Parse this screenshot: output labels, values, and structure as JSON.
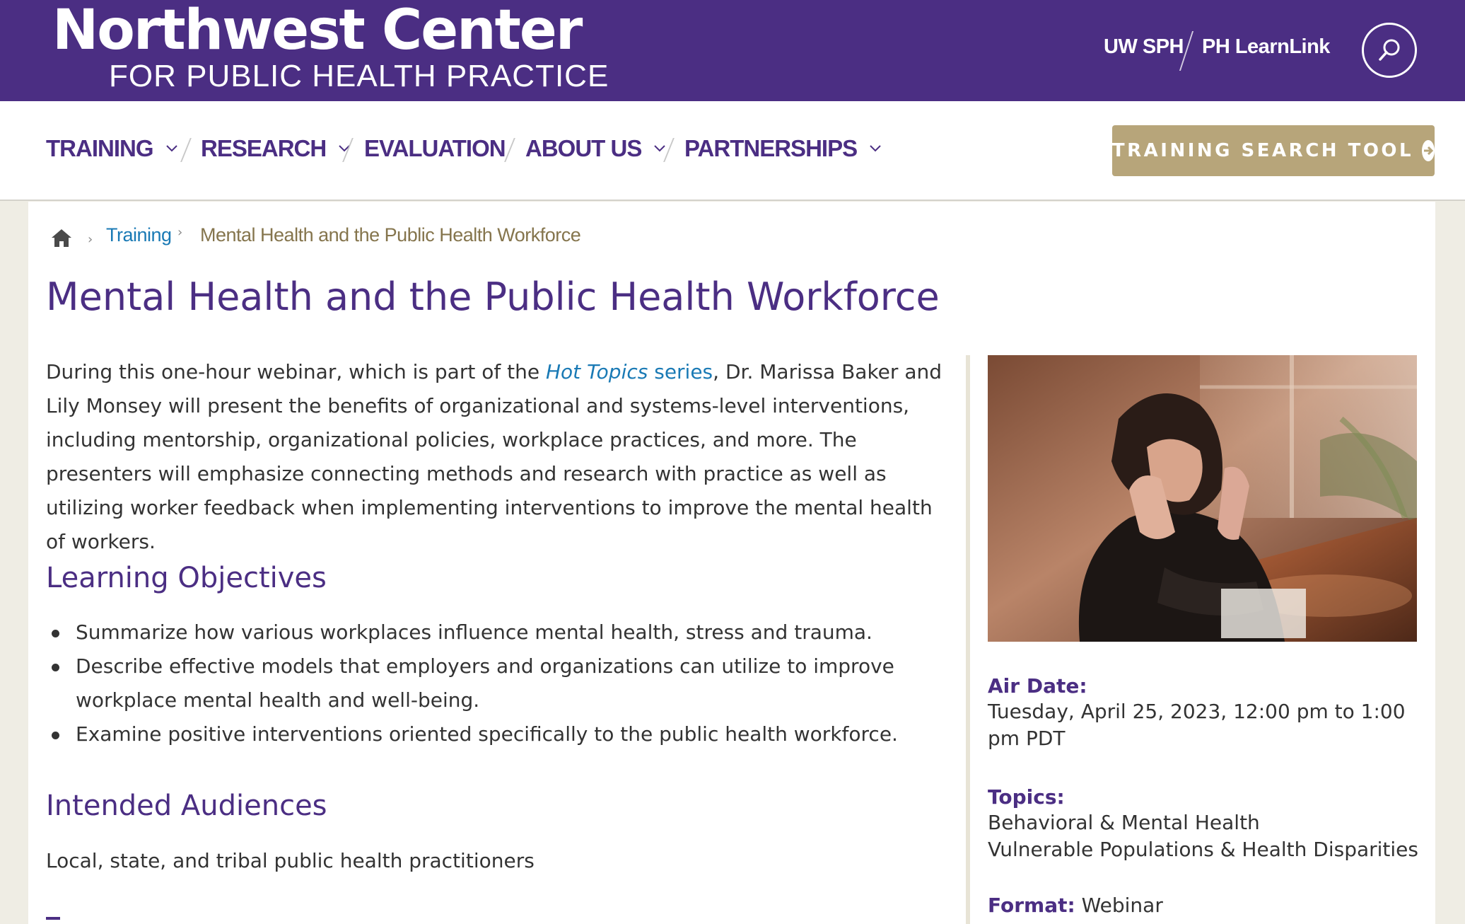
{
  "header": {
    "logo_main": "Northwest Center",
    "logo_sub": "FOR PUBLIC HEALTH PRACTICE",
    "util_links": [
      "UW SPH",
      "PH LearnLink"
    ],
    "search_icon": "search-icon",
    "brand_color": "#4b2e83"
  },
  "nav": {
    "items": [
      {
        "label": "TRAINING",
        "has_dropdown": true
      },
      {
        "label": "RESEARCH",
        "has_dropdown": true
      },
      {
        "label": "EVALUATION",
        "has_dropdown": false
      },
      {
        "label": "ABOUT US",
        "has_dropdown": true
      },
      {
        "label": "PARTNERSHIPS",
        "has_dropdown": true
      }
    ],
    "cta_label": "TRAINING SEARCH TOOL",
    "cta_icon": "arrow-circle-right-icon",
    "cta_color": "#b7a57a"
  },
  "breadcrumb": {
    "home_icon": "home-icon",
    "items": [
      "Training",
      "Mental Health and the Public Health Workforce"
    ]
  },
  "main": {
    "title": "Mental Health and the Public Health Workforce",
    "intro": {
      "before": "During this one-hour webinar, which is part of the ",
      "link_italic": "Hot Topics",
      "link_rest": " series",
      "after": ", Dr. Marissa Baker and Lily Monsey will present the benefits of organizational and systems-level interventions, including mentorship, organizational policies, workplace practices, and more. The presenters will emphasize connecting methods and research with practice as well as utilizing worker feedback when implementing interventions to improve the mental health of workers."
    },
    "objectives_heading": "Learning Objectives",
    "objectives": [
      "Summarize how various workplaces influence mental health, stress and trauma.",
      "Describe effective models that employers and organizations can utilize to improve workplace mental health and well-being.",
      "Examine positive interventions oriented specifically to the public health workforce."
    ],
    "audiences_heading": "Intended Audiences",
    "audiences_text": "Local, state, and tribal public health practitioners"
  },
  "sidebar": {
    "image_subject": "woman-holding-head-stress-photo",
    "air_date_label": "Air Date:",
    "air_date_value": "Tuesday, April 25, 2023, 12:00 pm to 1:00 pm PDT",
    "topics_label": "Topics:",
    "topics": [
      "Behavioral & Mental Health",
      "Vulnerable Populations & Health Disparities"
    ],
    "format_label": "Format:",
    "format_value": "Webinar"
  }
}
